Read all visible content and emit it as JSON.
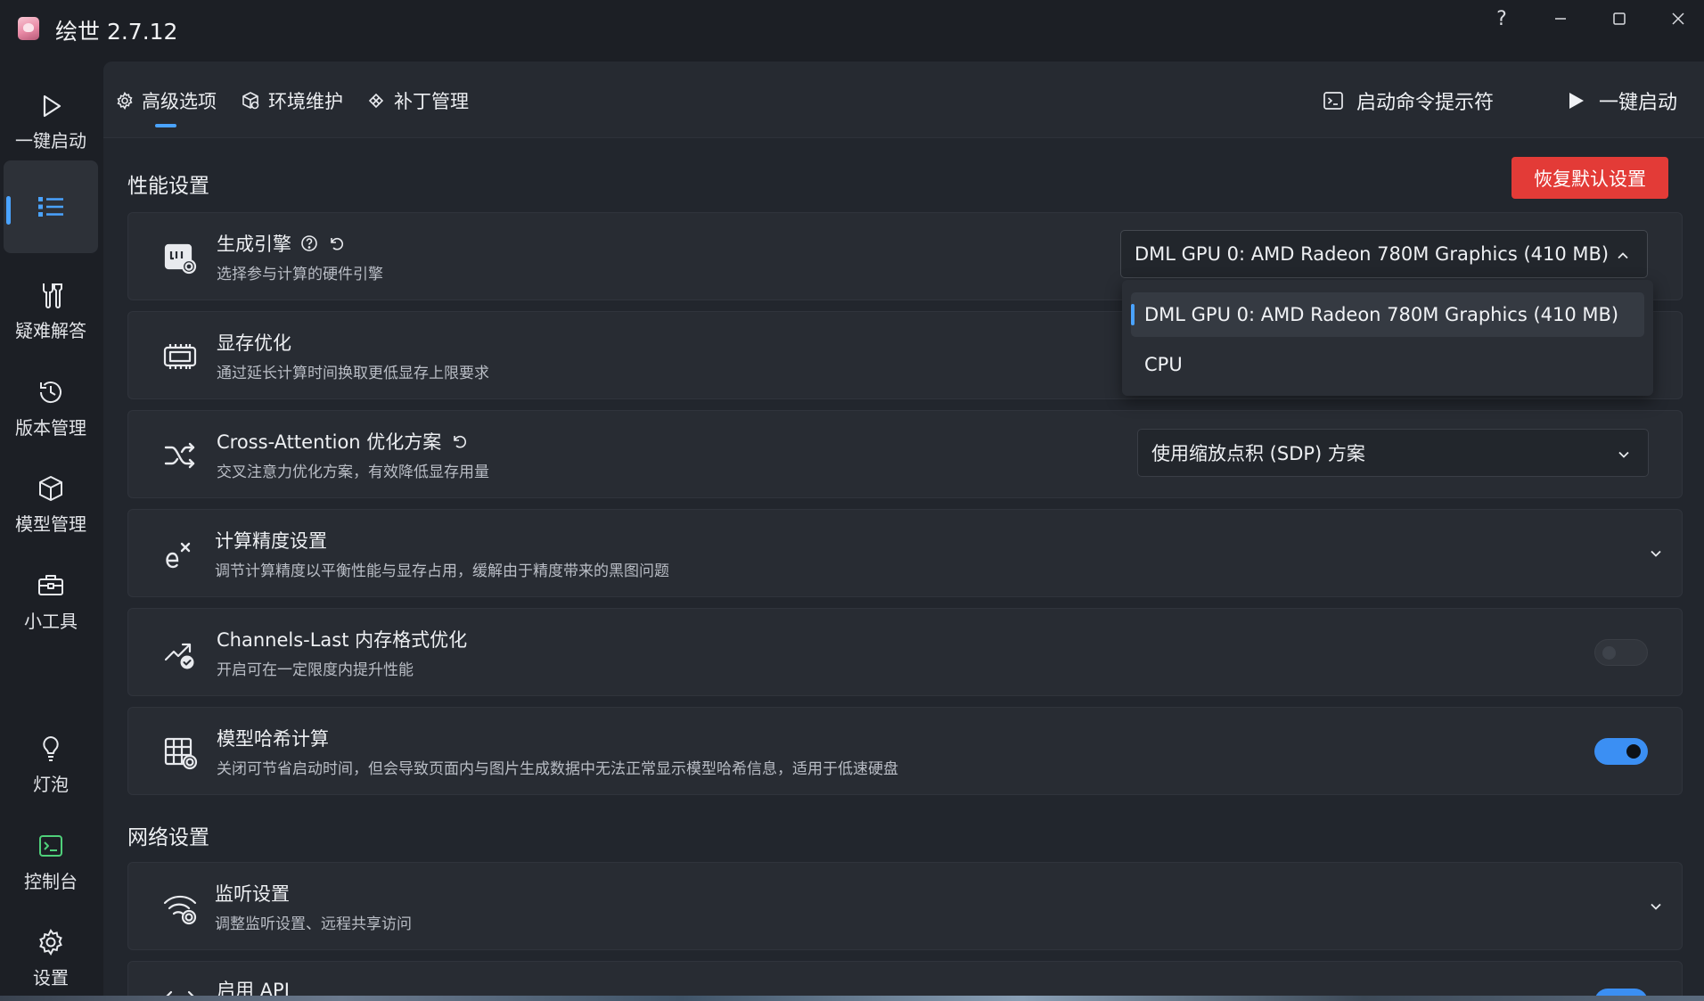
{
  "app": {
    "title": "绘世 2.7.12"
  },
  "window_controls": {
    "help": "?"
  },
  "nav": {
    "launch": "一键启动",
    "advanced": "",
    "troubleshoot": "疑难解答",
    "version": "版本管理",
    "models": "模型管理",
    "tools": "小工具",
    "bulb": "灯泡",
    "console": "控制台",
    "settings": "设置"
  },
  "tabs": [
    {
      "label": "高级选项",
      "active": true
    },
    {
      "label": "环境维护",
      "active": false
    },
    {
      "label": "补丁管理",
      "active": false
    }
  ],
  "actions": {
    "terminal": "启动命令提示符",
    "launch": "一键启动"
  },
  "performance": {
    "title": "性能设置",
    "reset": "恢复默认设置",
    "engine": {
      "title": "生成引擎",
      "desc": "选择参与计算的硬件引擎",
      "value": "DML GPU 0: AMD Radeon 780M Graphics (410 MB)",
      "options": [
        "DML GPU 0: AMD Radeon 780M Graphics (410 MB)",
        "CPU"
      ]
    },
    "vram": {
      "title": "显存优化",
      "desc": "通过延长计算时间换取更低显存上限要求"
    },
    "cross_attention": {
      "title": "Cross-Attention 优化方案",
      "desc": "交叉注意力优化方案，有效降低显存用量",
      "value": "使用缩放点积 (SDP) 方案"
    },
    "precision": {
      "title": "计算精度设置",
      "desc": "调节计算精度以平衡性能与显存占用，缓解由于精度带来的黑图问题"
    },
    "channels_last": {
      "title": "Channels-Last 内存格式优化",
      "desc": "开启可在一定限度内提升性能",
      "enabled": false
    },
    "hash": {
      "title": "模型哈希计算",
      "desc": "关闭可节省启动时间，但会导致页面内与图片生成数据中无法正常显示模型哈希信息，适用于低速硬盘",
      "enabled": true
    }
  },
  "network": {
    "title": "网络设置",
    "listen": {
      "title": "监听设置",
      "desc": "调整监听设置、远程共享访问"
    },
    "api": {
      "title": "启用 API",
      "enabled": true
    }
  },
  "colors": {
    "accent": "#3b8ff3",
    "danger": "#e33b37"
  }
}
